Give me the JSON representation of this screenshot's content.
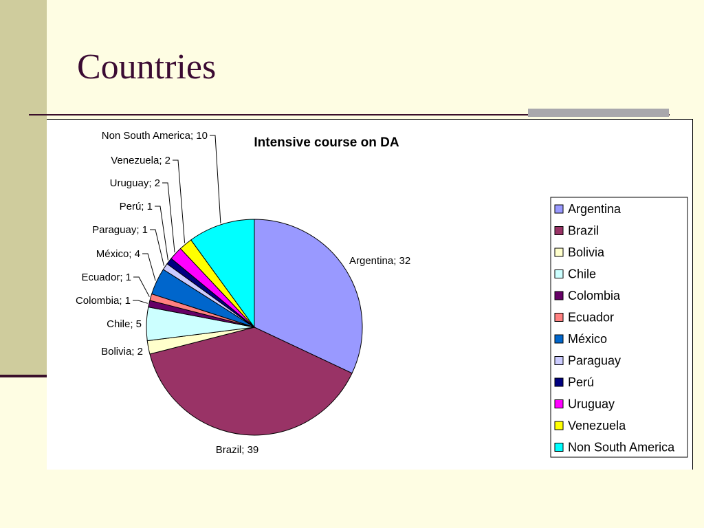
{
  "slide": {
    "title": "Countries"
  },
  "chart_data": {
    "type": "pie",
    "title": "Intensive course on DA",
    "start_angle_deg": 0,
    "direction": "clockwise",
    "legend_position": "right",
    "slices": [
      {
        "label": "Argentina",
        "value": 32,
        "color": "#9999ff",
        "data_label": "Argentina; 32"
      },
      {
        "label": "Brazil",
        "value": 39,
        "color": "#993366",
        "data_label": "Brazil; 39"
      },
      {
        "label": "Bolivia",
        "value": 2,
        "color": "#ffffcc",
        "data_label": "Bolivia; 2"
      },
      {
        "label": "Chile",
        "value": 5,
        "color": "#ccffff",
        "data_label": "Chile; 5"
      },
      {
        "label": "Colombia",
        "value": 1,
        "color": "#660066",
        "data_label": "Colombia; 1"
      },
      {
        "label": "Ecuador",
        "value": 1,
        "color": "#ff8080",
        "data_label": "Ecuador; 1"
      },
      {
        "label": "México",
        "value": 4,
        "color": "#0066cc",
        "data_label": "México; 4"
      },
      {
        "label": "Paraguay",
        "value": 1,
        "color": "#ccccff",
        "data_label": "Paraguay; 1"
      },
      {
        "label": "Perú",
        "value": 1,
        "color": "#000080",
        "data_label": "Perú; 1"
      },
      {
        "label": "Uruguay",
        "value": 2,
        "color": "#ff00ff",
        "data_label": "Uruguay; 2"
      },
      {
        "label": "Venezuela",
        "value": 2,
        "color": "#ffff00",
        "data_label": "Venezuela; 2"
      },
      {
        "label": "Non South America",
        "value": 10,
        "color": "#00ffff",
        "data_label": "Non South America; 10"
      }
    ]
  }
}
